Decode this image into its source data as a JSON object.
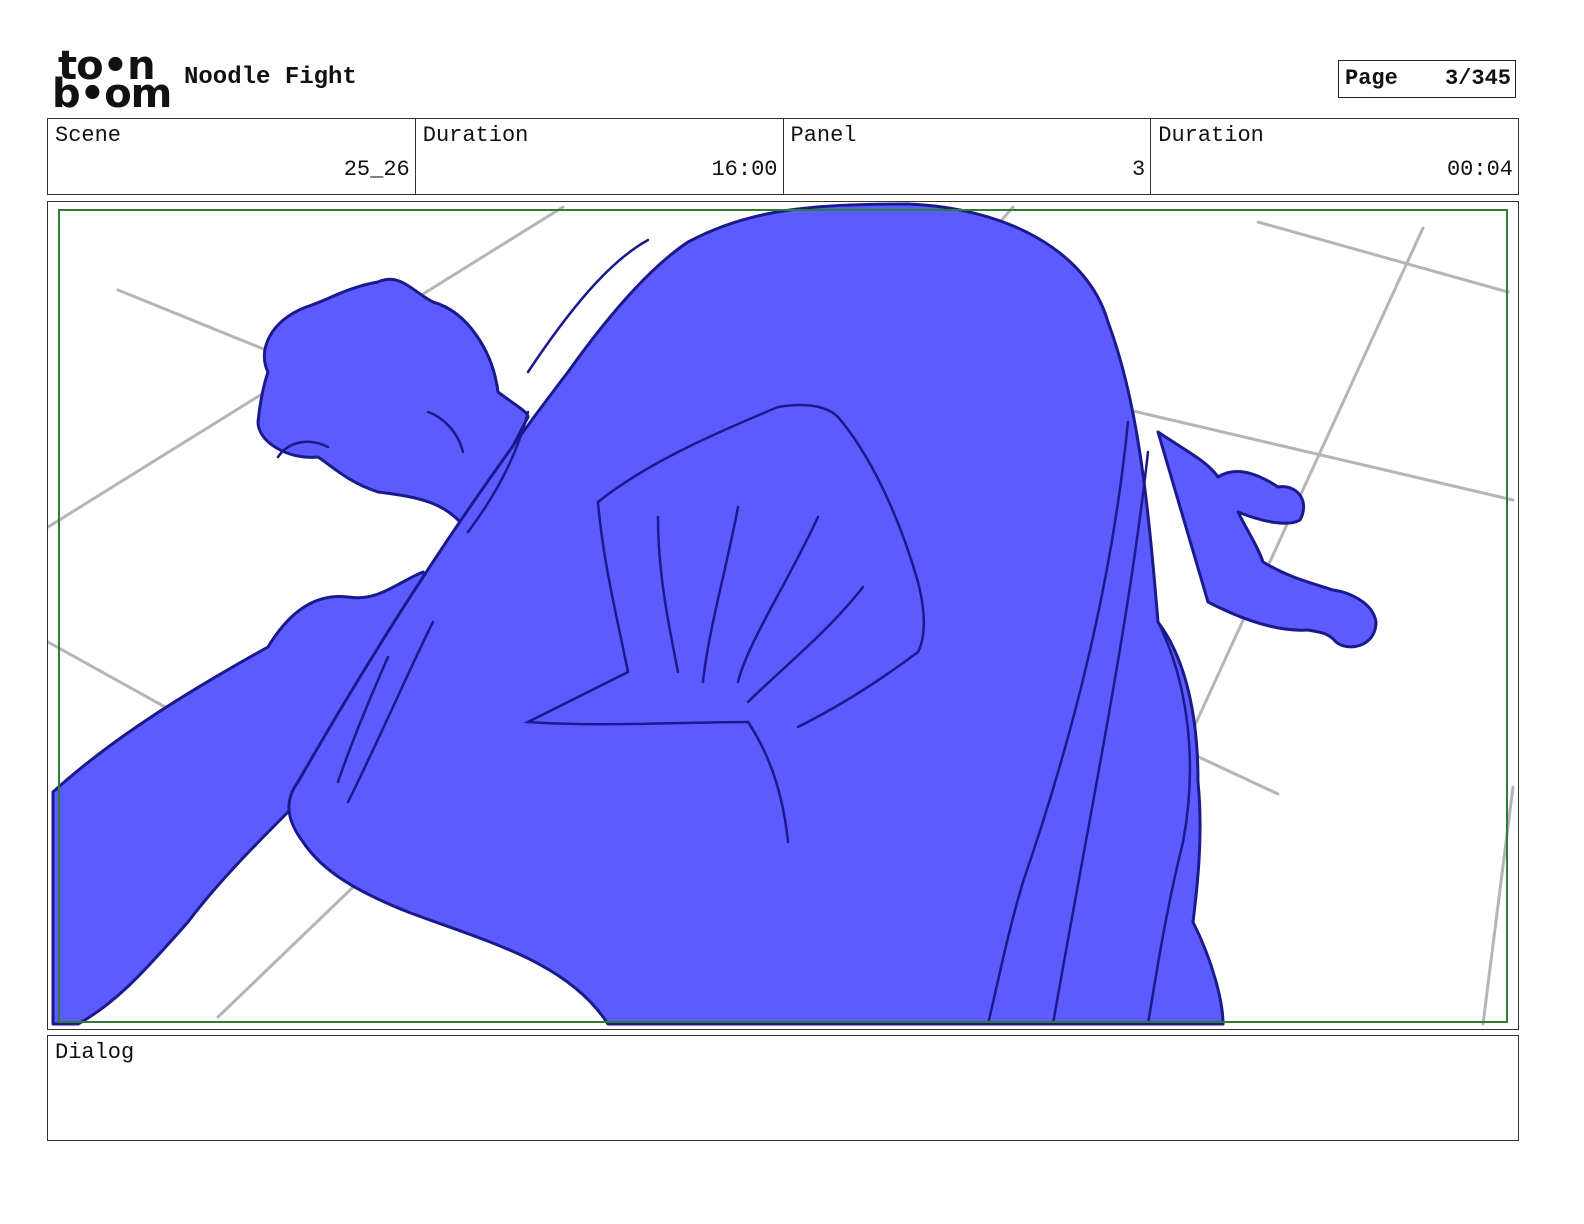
{
  "header": {
    "logo_top": "to•n",
    "logo_bottom": "b•om",
    "title": "Noodle Fight",
    "page_label": "Page",
    "page_number": "3/345"
  },
  "info": {
    "scene_label": "Scene",
    "scene_value": "25_26",
    "scene_duration_label": "Duration",
    "scene_duration_value": "16:00",
    "panel_label": "Panel",
    "panel_value": "3",
    "panel_duration_label": "Duration",
    "panel_duration_value": "00:04"
  },
  "dialog": {
    "label": "Dialog",
    "text": ""
  },
  "colors": {
    "fill": "#5b5bff",
    "outline": "#1a1a8c",
    "safe_area": "#2e7d32",
    "floor_lines": "#b5b5b5"
  }
}
